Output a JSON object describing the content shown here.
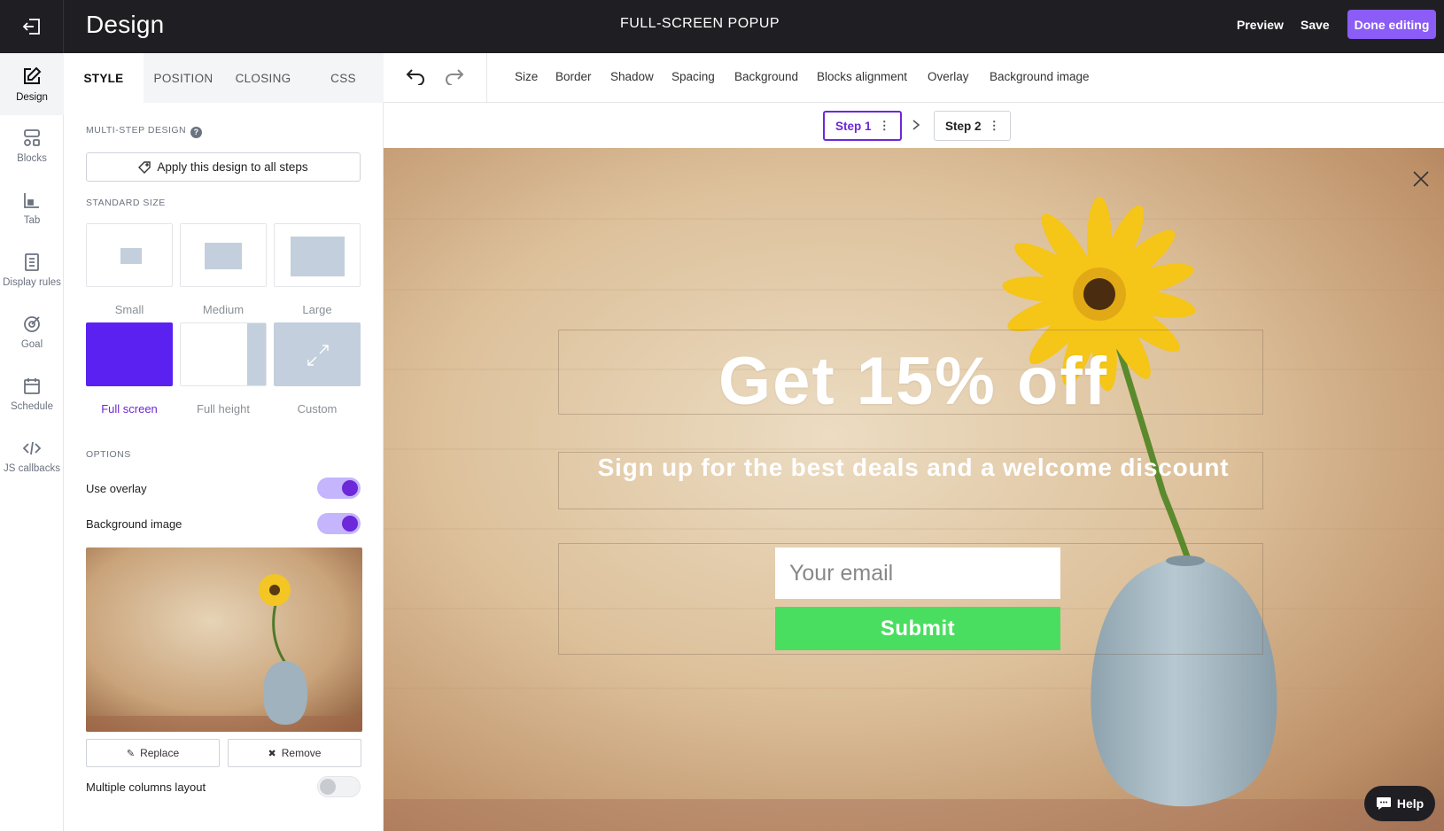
{
  "topbar": {
    "title": "Design",
    "popup_type": "FULL-SCREEN POPUP",
    "preview": "Preview",
    "save": "Save",
    "done": "Done editing"
  },
  "rail": {
    "items": [
      {
        "label": "Design",
        "icon": "pencil-square-icon",
        "active": true
      },
      {
        "label": "Blocks",
        "icon": "blocks-icon"
      },
      {
        "label": "Tab",
        "icon": "tab-icon"
      },
      {
        "label": "Display rules",
        "icon": "document-icon"
      },
      {
        "label": "Goal",
        "icon": "target-icon"
      },
      {
        "label": "Schedule",
        "icon": "calendar-icon"
      },
      {
        "label": "JS callbacks",
        "icon": "code-icon"
      }
    ]
  },
  "panel": {
    "tabs": [
      "STYLE",
      "POSITION",
      "CLOSING",
      "CSS"
    ],
    "multi_step_label": "MULTI-STEP DESIGN",
    "apply_label": "Apply this design to all steps",
    "standard_size_label": "STANDARD SIZE",
    "sizes": [
      "Small",
      "Medium",
      "Large",
      "Full screen",
      "Full height",
      "Custom"
    ],
    "selected_size": "Full screen",
    "options_label": "OPTIONS",
    "use_overlay": "Use overlay",
    "background_image": "Background image",
    "replace": "Replace",
    "remove": "Remove",
    "multiple_columns": "Multiple columns layout",
    "accent_color": "#6d28d9"
  },
  "toolbar": {
    "items": [
      "Size",
      "Border",
      "Shadow",
      "Spacing",
      "Background",
      "Blocks alignment",
      "Overlay",
      "Background image"
    ]
  },
  "steps": {
    "step1": "Step 1",
    "step2": "Step 2",
    "dots": "⋮"
  },
  "popup": {
    "headline": "Get 15% off",
    "subheadline": "Sign up for the best deals and a welcome discount",
    "email_placeholder": "Your email",
    "submit": "Submit",
    "submit_color": "#4ade60"
  },
  "help": "Help"
}
